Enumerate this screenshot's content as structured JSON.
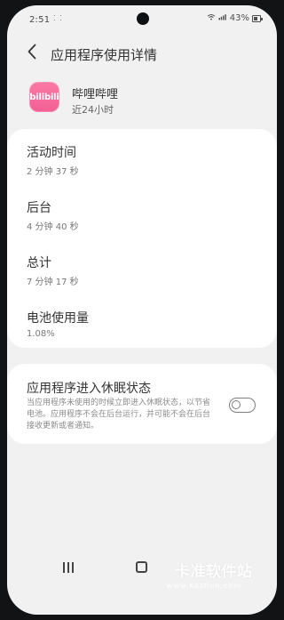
{
  "status_bar": {
    "time": "2:51",
    "indicator": "⁚ ⁚",
    "battery": "43%",
    "icons": {
      "wifi": "wifi-icon",
      "signal": "signal-icon",
      "battery": "battery-icon"
    }
  },
  "header": {
    "back_icon": "chevron-left-icon",
    "title": "应用程序使用详情"
  },
  "app": {
    "name": "哔哩哔哩",
    "period": "近24小时",
    "icon_label": "bilibili",
    "icon_name": "bilibili-app-icon"
  },
  "usage": {
    "items": [
      {
        "title": "活动时间",
        "value": "2 分钟 37 秒"
      },
      {
        "title": "后台",
        "value": "4 分钟 40 秒"
      },
      {
        "title": "总计",
        "value": "7 分钟 17 秒"
      },
      {
        "title": "电池使用量",
        "value": "1.08%"
      }
    ]
  },
  "sleep_setting": {
    "title": "应用程序进入休眠状态",
    "description": "当应用程序未使用的时候立即进入休眠状态，以节省电池。应用程序不会在后台运行，并可能不会在后台接收更新或者通知。",
    "toggle_state": "off",
    "toggle_icon": "toggle-switch-icon"
  },
  "navigation": {
    "recent_icon": "recent-apps-icon",
    "home_icon": "home-icon"
  },
  "watermark": {
    "title": "卡准软件站",
    "url": "www.kazhun.com"
  }
}
